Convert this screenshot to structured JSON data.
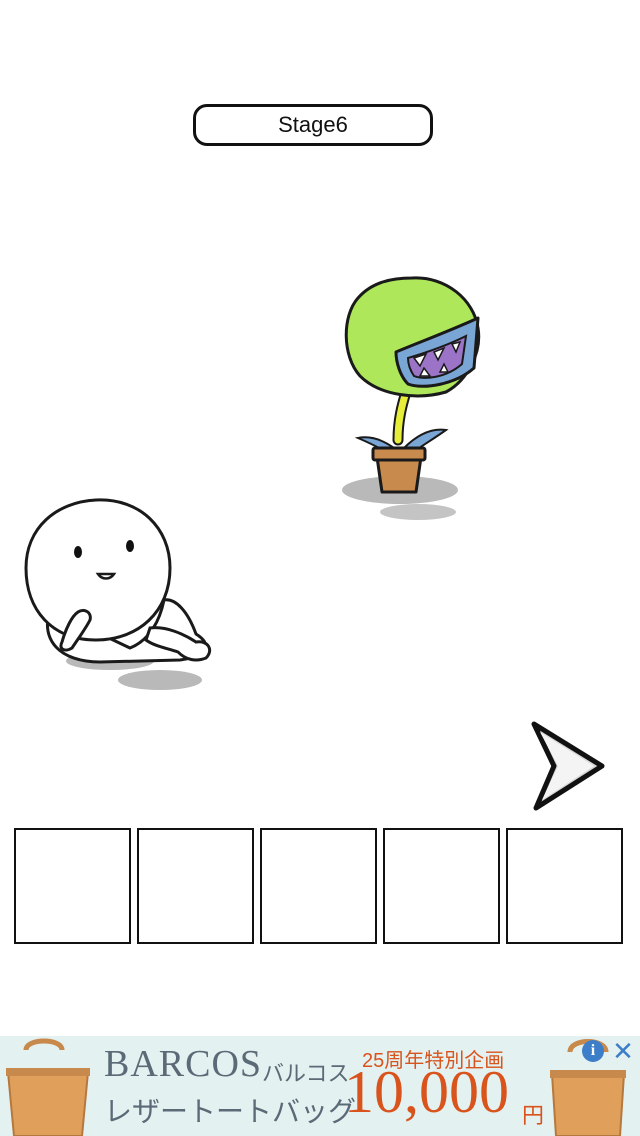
{
  "stage": {
    "label": "Stage6"
  },
  "inventory": {
    "slots": [
      "",
      "",
      "",
      "",
      ""
    ]
  },
  "navigation": {
    "next_icon": "right-arrow-icon"
  },
  "ad": {
    "brand": "BARCOS",
    "brand_kana": "バルコス",
    "product": "レザートートバッグ",
    "anniversary": "25周年特別企画",
    "price": "10,000",
    "currency": "円",
    "info_icon": "i",
    "close_icon": "✕",
    "colors": {
      "background": "#e4f1f1",
      "brand": "#5a6a76",
      "price": "#d8541c",
      "controls": "#3d7ec8"
    }
  },
  "colors": {
    "plant_head": "#aee85a",
    "plant_mouth": "#9b74c8",
    "pot": "#c98a4e",
    "leaf": "#7aa6d6"
  }
}
